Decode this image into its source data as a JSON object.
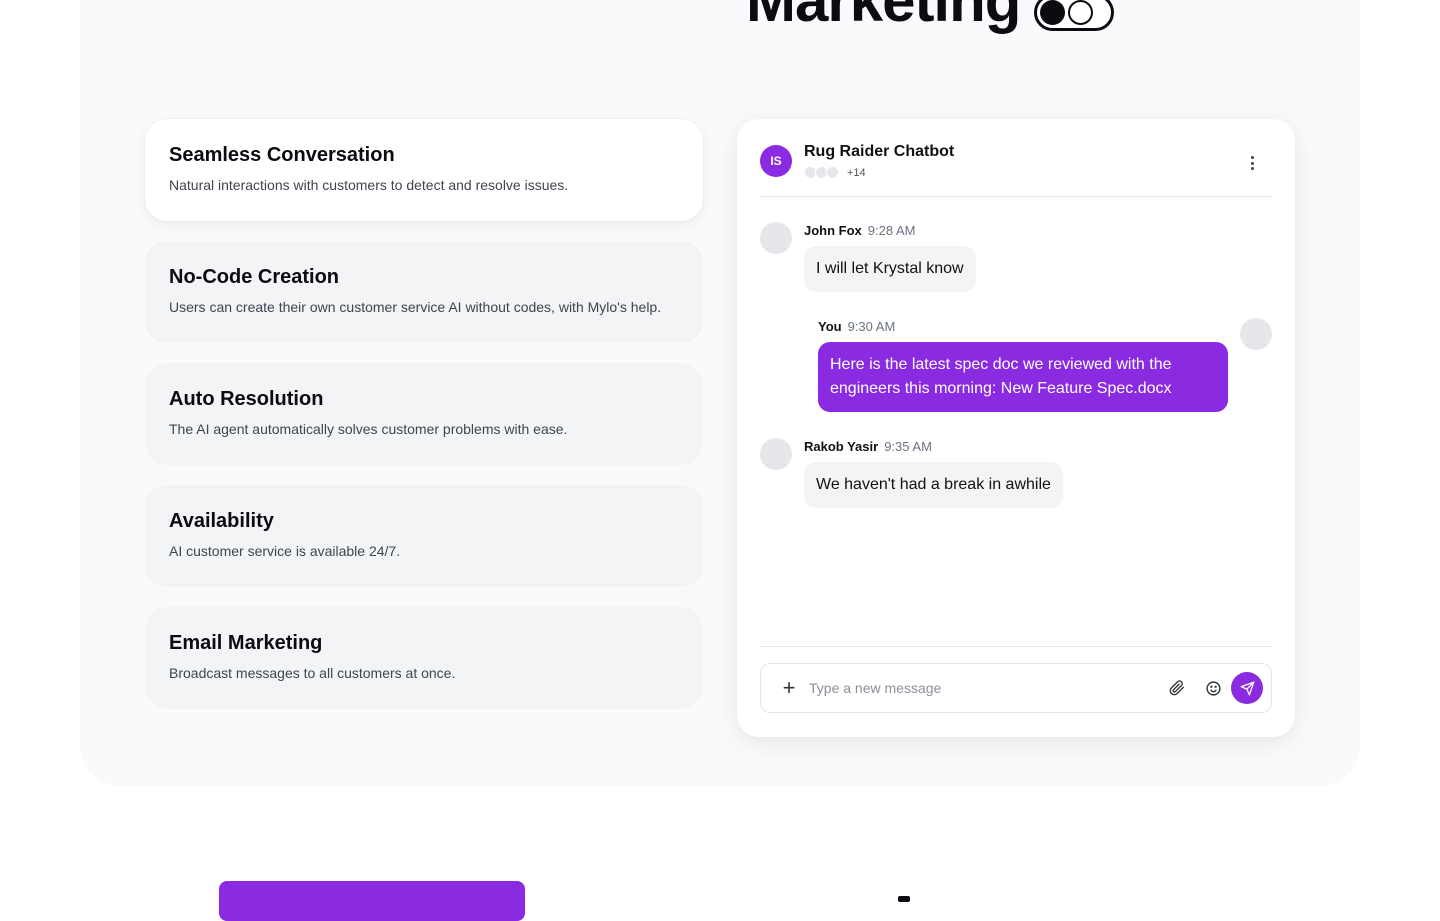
{
  "hero": {
    "title": "Marketing"
  },
  "features": [
    {
      "title": "Seamless Conversation",
      "desc": "Natural interactions with customers to detect and resolve issues."
    },
    {
      "title": "No-Code Creation",
      "desc": "Users can create their own customer service AI without codes, with Mylo's help."
    },
    {
      "title": "Auto Resolution",
      "desc": "The AI agent automatically solves customer problems with ease."
    },
    {
      "title": "Availability",
      "desc": "AI customer service is available 24/7."
    },
    {
      "title": "Email Marketing",
      "desc": "Broadcast messages to all customers at once."
    }
  ],
  "chat": {
    "bot_initials": "IS",
    "bot_name": "Rug Raider Chatbot",
    "member_count": "+14",
    "messages": [
      {
        "name": "John Fox",
        "time": "9:28 AM",
        "text": "I will let Krystal know"
      },
      {
        "name": "You",
        "time": "9:30 AM",
        "text": "Here is the latest spec doc we reviewed with the engineers this morning: New Feature Spec.docx"
      },
      {
        "name": "Rakob Yasir",
        "time": "9:35 AM",
        "text": "We haven't had a break in awhile"
      }
    ],
    "composer": {
      "placeholder": "Type a new message",
      "value": ""
    }
  },
  "colors": {
    "accent": "#8a2be2",
    "section_bg": "#f9fafb",
    "card_bg": "#f3f4f6"
  }
}
